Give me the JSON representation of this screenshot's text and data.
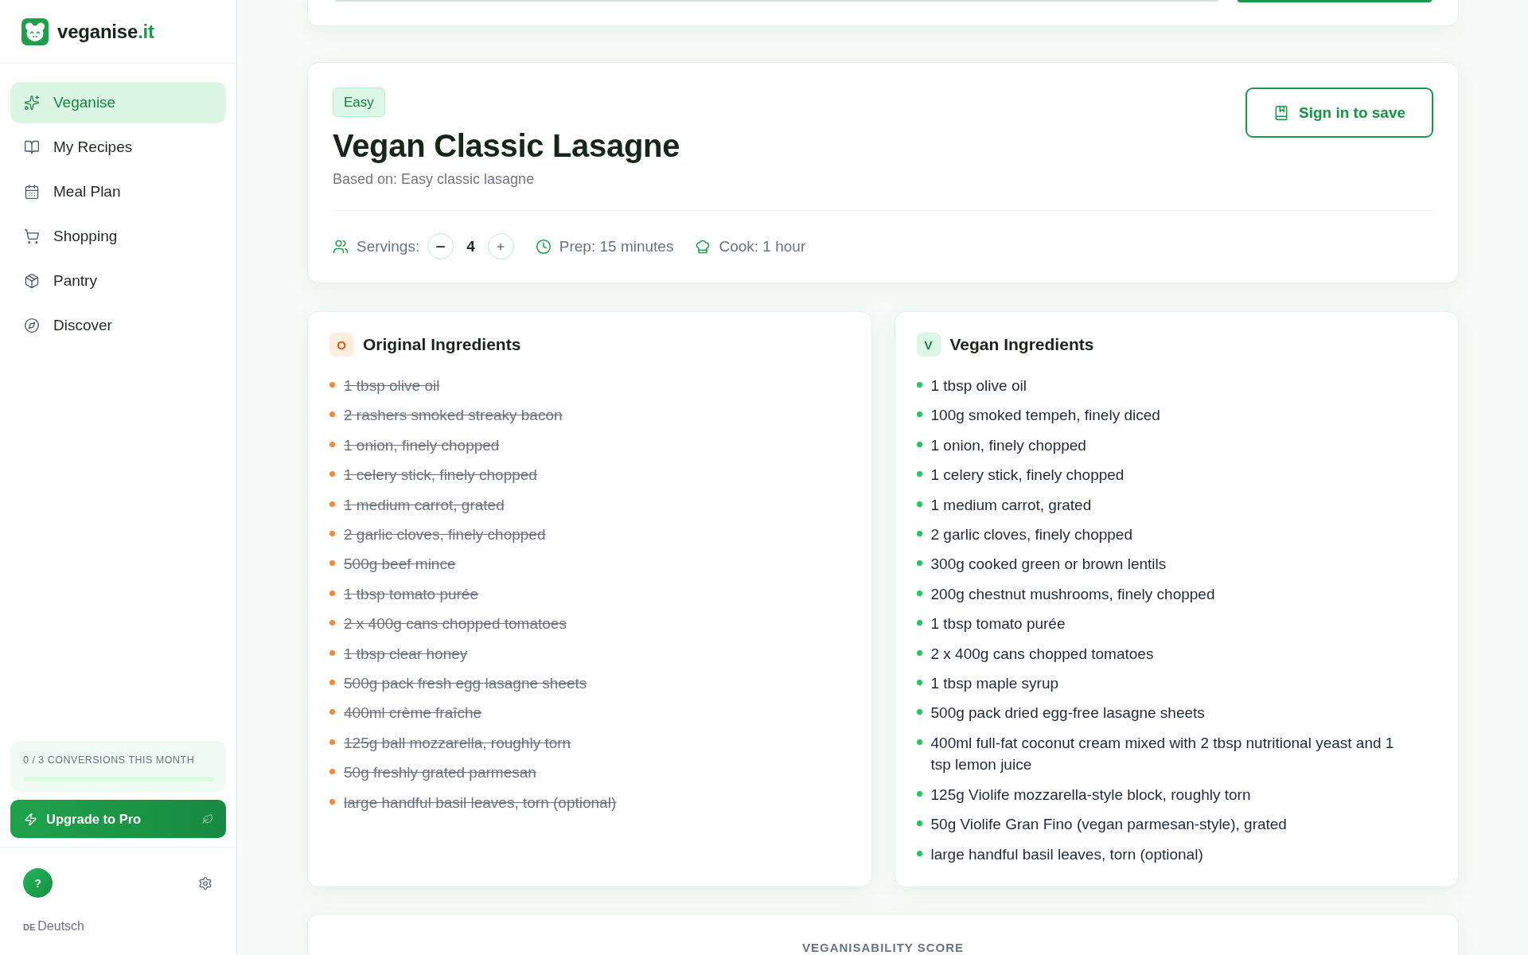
{
  "sidebar": {
    "logo": {
      "text": "veganise",
      "domain": ".it"
    },
    "nav_items": [
      {
        "label": "Veganise",
        "selected": true
      },
      {
        "label": "My Recipes",
        "selected": false
      },
      {
        "label": "Meal Plan",
        "selected": false
      },
      {
        "label": "Shopping",
        "selected": false
      },
      {
        "label": "Pantry",
        "selected": false
      },
      {
        "label": "Discover",
        "selected": false
      }
    ],
    "usage": {
      "label": "0 / 3 CONVERSIONS THIS MONTH"
    },
    "upgrade_button": "Upgrade to Pro",
    "help_button": "?",
    "language": {
      "code": "DE",
      "label": "Deutsch"
    }
  },
  "recipe": {
    "difficulty": "Easy",
    "title": "Vegan Classic Lasagne",
    "based_on": "Based on: Easy classic lasagne",
    "save_button": "Sign in to save",
    "servings": {
      "label": "Servings:",
      "value": "4"
    },
    "prep": "Prep: 15 minutes",
    "cook": "Cook: 1 hour"
  },
  "ingredient_panels": [
    {
      "kind": "original",
      "badge": "O",
      "title": "Original Ingredients",
      "items": [
        "1 tbsp olive oil",
        "2 rashers smoked streaky bacon",
        "1 onion, finely chopped",
        "1 celery stick, finely chopped",
        "1 medium carrot, grated",
        "2 garlic cloves, finely chopped",
        "500g beef mince",
        "1 tbsp tomato purée",
        "2 x 400g cans chopped tomatoes",
        "1 tbsp clear honey",
        "500g pack fresh egg lasagne sheets",
        "400ml crème fraîche",
        "125g ball mozzarella, roughly torn",
        "50g freshly grated parmesan",
        "large handful basil leaves, torn (optional)"
      ]
    },
    {
      "kind": "vegan",
      "badge": "V",
      "title": "Vegan Ingredients",
      "items": [
        "1 tbsp olive oil",
        "100g smoked tempeh, finely diced",
        "1 onion, finely chopped",
        "1 celery stick, finely chopped",
        "1 medium carrot, grated",
        "2 garlic cloves, finely chopped",
        "300g cooked green or brown lentils",
        "200g chestnut mushrooms, finely chopped",
        "1 tbsp tomato purée",
        "2 x 400g cans chopped tomatoes",
        "1 tbsp maple syrup",
        "500g pack dried egg-free lasagne sheets",
        "400ml full-fat coconut cream mixed with 2 tbsp nutritional yeast and 1 tsp lemon juice",
        "125g Violife mozzarella-style block, roughly torn",
        "50g Violife Gran Fino (vegan parmesan-style), grated",
        "large handful basil leaves, torn (optional)"
      ]
    }
  ],
  "score_section": {
    "title": "VEGANISABILITY SCORE"
  }
}
